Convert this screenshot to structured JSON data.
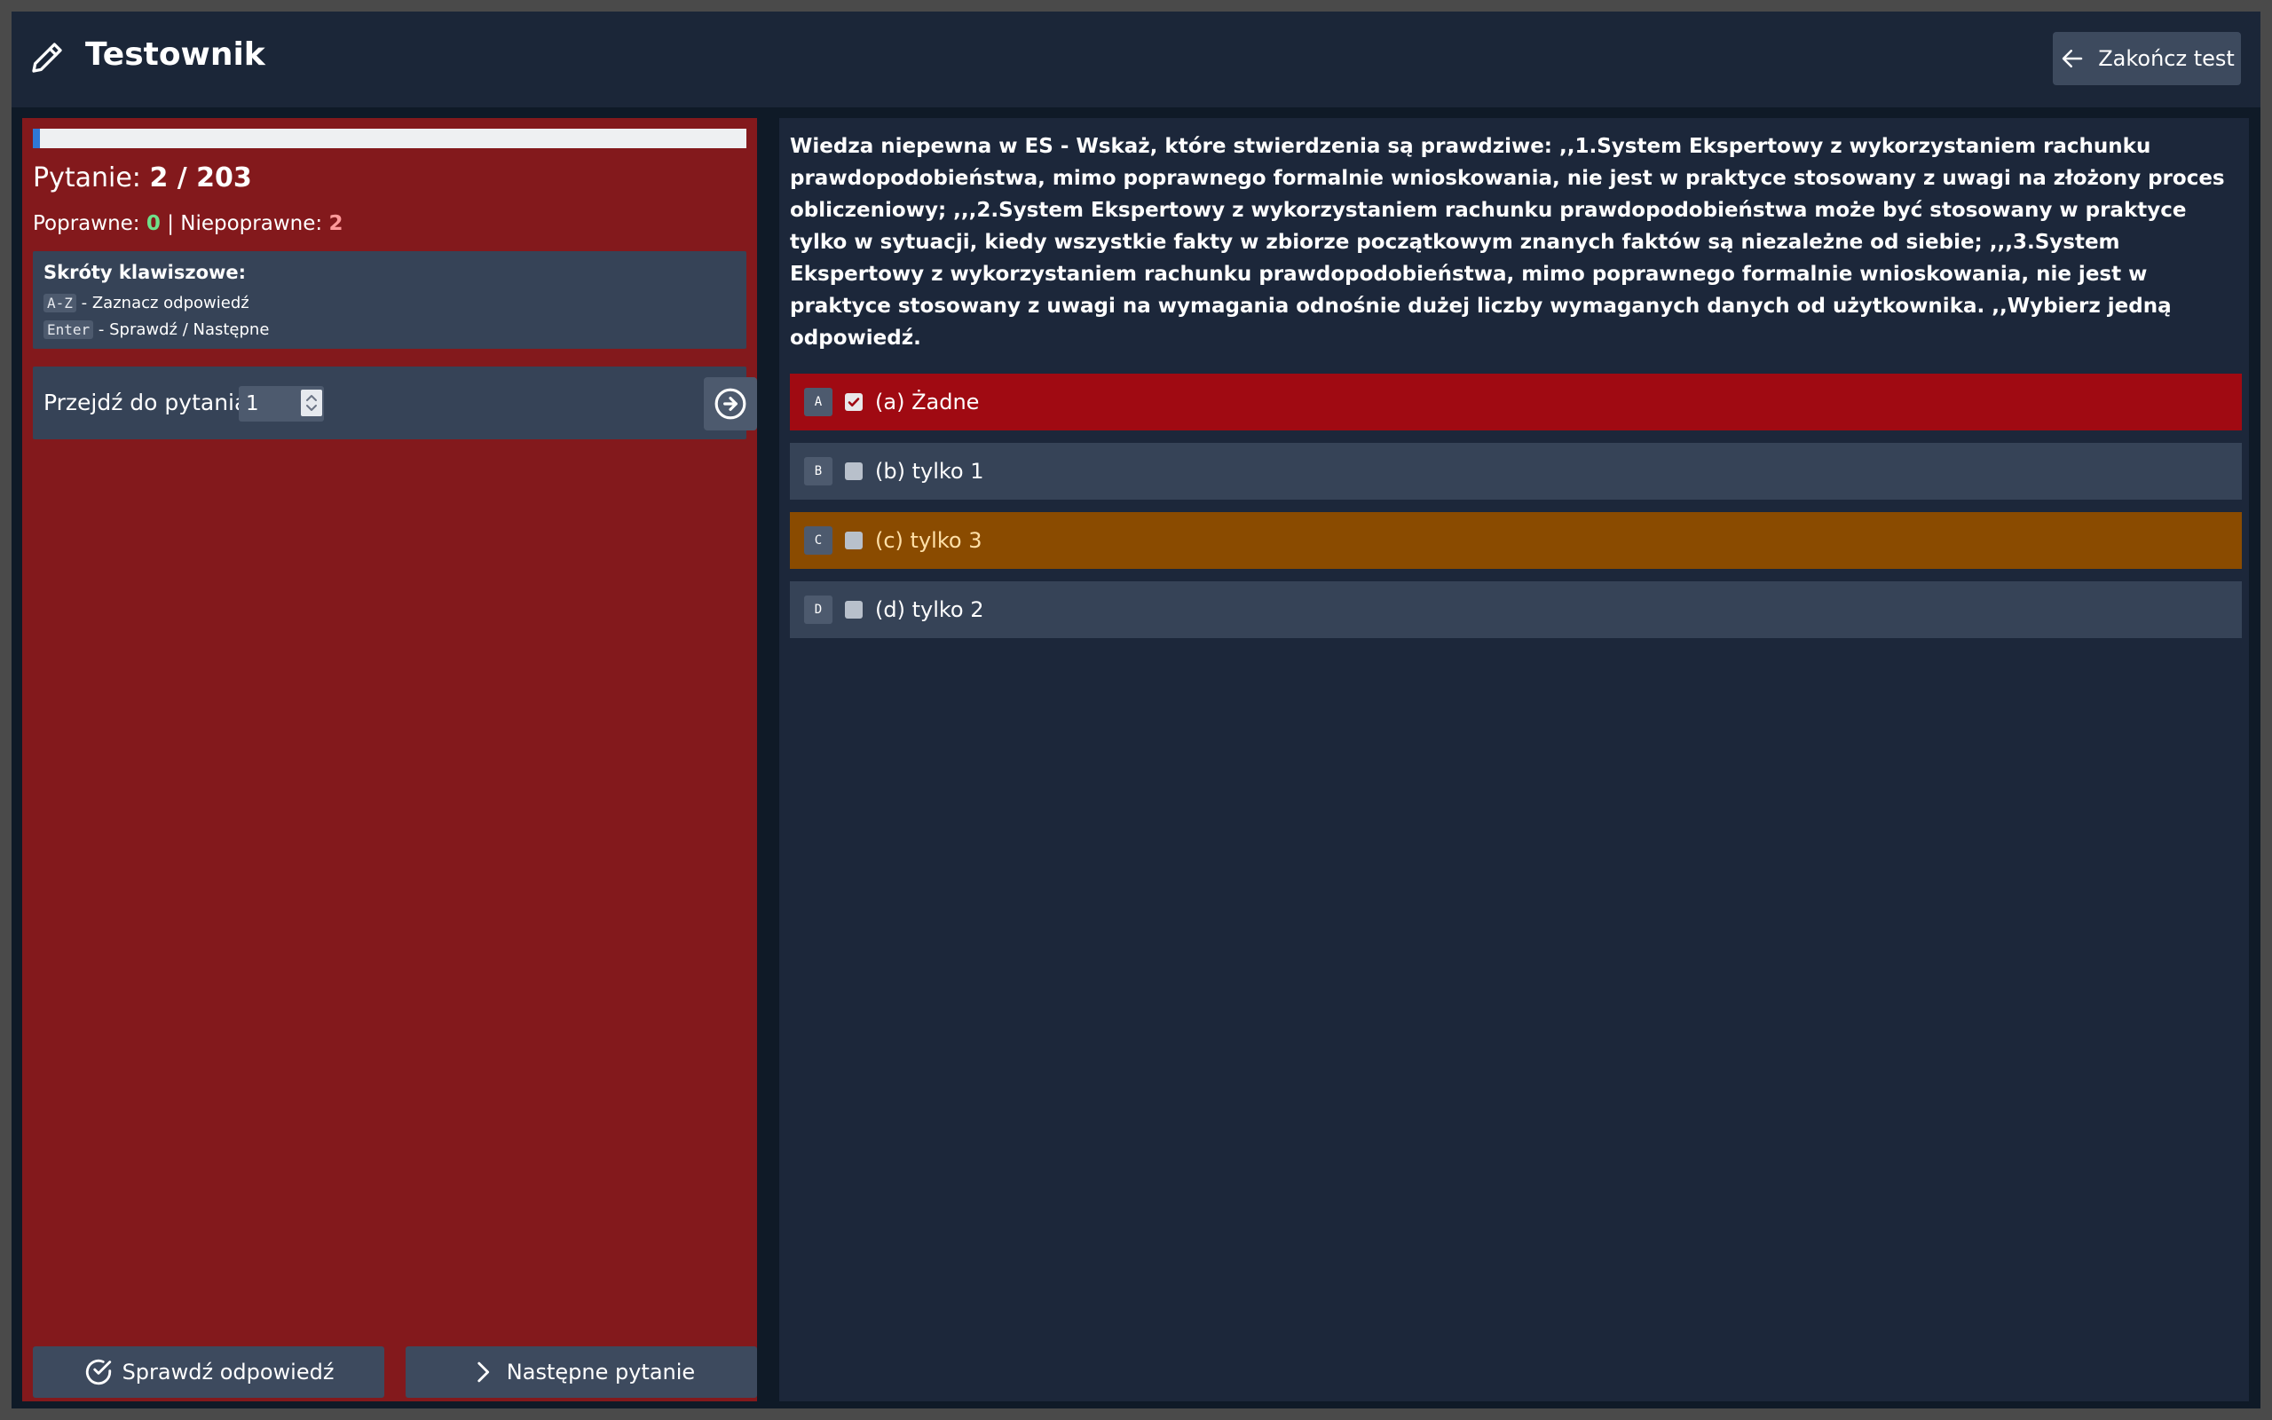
{
  "header": {
    "app_title": "Testownik",
    "end_button_label": "Zakończ test"
  },
  "progress": {
    "current": 2,
    "total": 203,
    "fraction": 0.00985
  },
  "counter": {
    "label": "Pytanie: ",
    "value": "2 / 203"
  },
  "stats": {
    "correct_label": "Poprawne: ",
    "correct_value": "0",
    "separator": " | ",
    "incorrect_label": "Niepoprawne: ",
    "incorrect_value": "2"
  },
  "shortcuts": {
    "title": "Skróty klawiszowe:",
    "items": [
      {
        "key": "A-Z",
        "desc": " - Zaznacz odpowiedź"
      },
      {
        "key": "Enter",
        "desc": " - Sprawdź / Następne"
      }
    ]
  },
  "jump": {
    "label": "Przejdź do pytania",
    "value": "1"
  },
  "buttons": {
    "check_label": "Sprawdź odpowiedź",
    "next_label": "Następne pytanie"
  },
  "question": {
    "text": "Wiedza niepewna w ES - Wskaż, które stwierdzenia są prawdziwe: ,,1.System Ekspertowy z wykorzystaniem rachunku prawdopodobieństwa, mimo poprawnego formalnie wnioskowania, nie jest w praktyce stosowany z uwagi na złożony proces obliczeniowy; ,,,2.System Ekspertowy z wykorzystaniem rachunku prawdopodobieństwa może być stosowany w praktyce tylko w sytuacji, kiedy wszystkie fakty w zbiorze początkowym znanych faktów są niezależne od siebie; ,,,3.System Ekspertowy z wykorzystaniem rachunku prawdopodobieństwa, mimo poprawnego formalnie wnioskowania, nie jest w praktyce stosowany z uwagi na wymagania odnośnie dużej liczby wymaganych danych od użytkownika. ,,Wybierz jedną odpowiedź."
  },
  "answers": [
    {
      "letter": "A",
      "label": "(a) Żadne",
      "checked": true,
      "state": "selected"
    },
    {
      "letter": "B",
      "label": "(b) tylko 1",
      "checked": false,
      "state": "normal"
    },
    {
      "letter": "C",
      "label": "(c) tylko 3",
      "checked": false,
      "state": "highlight"
    },
    {
      "letter": "D",
      "label": "(d) tylko 2",
      "checked": false,
      "state": "normal"
    }
  ],
  "colors": {
    "left_panel": "#83191c",
    "selected_wrong": "#a00a12",
    "highlight": "#8a4b00",
    "correct_text": "#6fe08a",
    "incorrect_text": "#ff9a9a"
  }
}
